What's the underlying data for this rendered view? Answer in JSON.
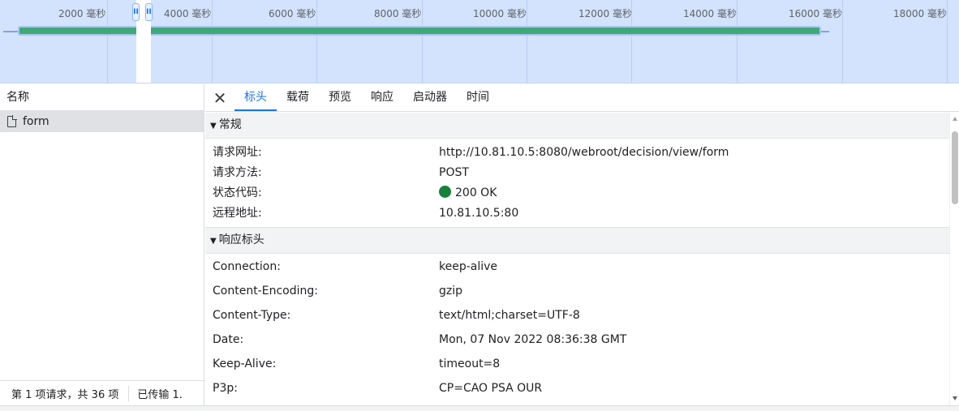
{
  "timeline": {
    "ticks": [
      "2000 毫秒",
      "4000 毫秒",
      "6000 毫秒",
      "8000 毫秒",
      "10000 毫秒",
      "12000 毫秒",
      "14000 毫秒",
      "16000 毫秒",
      "18000 毫秒"
    ],
    "handle_left": "II",
    "handle_right": "II"
  },
  "request_list": {
    "header": "名称",
    "items": [
      {
        "name": "form"
      }
    ],
    "status": {
      "requests": "第 1 项请求，共 36 项",
      "transferred": "已传输 1."
    }
  },
  "tabs": {
    "close": "✕",
    "items": [
      "标头",
      "载荷",
      "预览",
      "响应",
      "启动器",
      "时间"
    ],
    "active": "标头"
  },
  "general": {
    "title": "常规",
    "rows": [
      {
        "key": "请求网址:",
        "value": "http://10.81.10.5:8080/webroot/decision/view/form"
      },
      {
        "key": "请求方法:",
        "value": "POST"
      },
      {
        "key": "状态代码:",
        "value": "200 OK"
      },
      {
        "key": "远程地址:",
        "value": "10.81.10.5:80"
      }
    ]
  },
  "response_headers": {
    "title": "响应标头",
    "rows": [
      {
        "key": "Connection:",
        "value": "keep-alive"
      },
      {
        "key": "Content-Encoding:",
        "value": "gzip"
      },
      {
        "key": "Content-Type:",
        "value": "text/html;charset=UTF-8"
      },
      {
        "key": "Date:",
        "value": "Mon, 07 Nov 2022 08:36:38 GMT"
      },
      {
        "key": "Keep-Alive:",
        "value": "timeout=8"
      },
      {
        "key": "P3p:",
        "value": "CP=CAO PSA OUR"
      }
    ]
  },
  "colors": {
    "accent": "#1a73e8",
    "status_ok": "#188038",
    "waterfall": "#41a878",
    "timeline_bg": "#d3e3fd"
  }
}
